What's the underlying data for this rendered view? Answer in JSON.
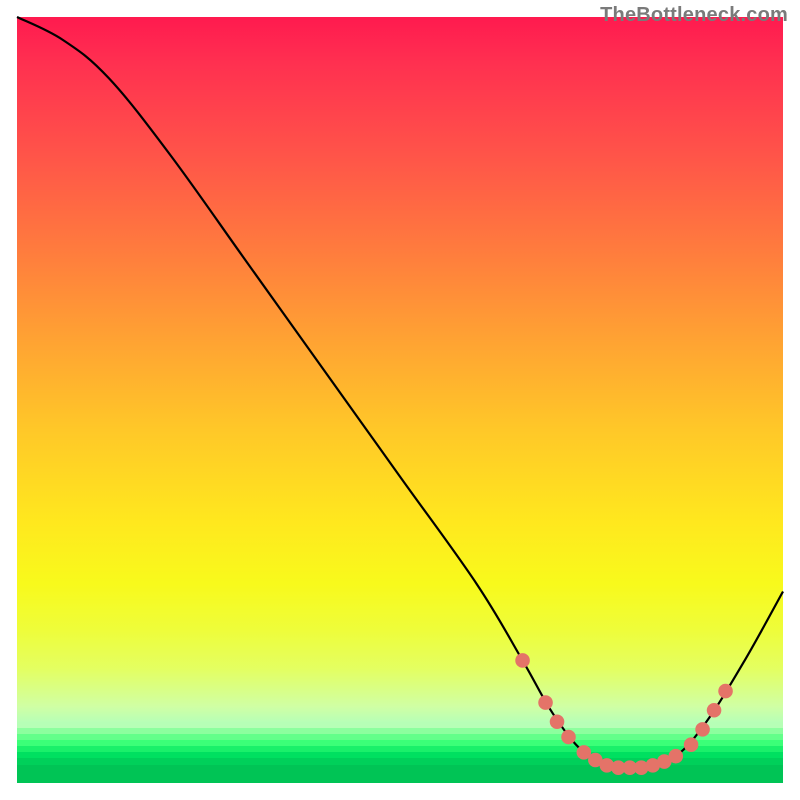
{
  "attribution": "TheBottleneck.com",
  "chart_data": {
    "type": "line",
    "title": "",
    "xlabel": "",
    "ylabel": "",
    "xlim": [
      0,
      100
    ],
    "ylim": [
      0,
      100
    ],
    "grid": false,
    "curve_points": [
      {
        "x": 0,
        "y": 100
      },
      {
        "x": 6,
        "y": 97
      },
      {
        "x": 12,
        "y": 92
      },
      {
        "x": 20,
        "y": 82
      },
      {
        "x": 30,
        "y": 68
      },
      {
        "x": 40,
        "y": 54
      },
      {
        "x": 50,
        "y": 40
      },
      {
        "x": 60,
        "y": 26
      },
      {
        "x": 66,
        "y": 16
      },
      {
        "x": 70,
        "y": 9
      },
      {
        "x": 74,
        "y": 4
      },
      {
        "x": 78,
        "y": 2
      },
      {
        "x": 82,
        "y": 2
      },
      {
        "x": 86,
        "y": 3.5
      },
      {
        "x": 90,
        "y": 8
      },
      {
        "x": 95,
        "y": 16
      },
      {
        "x": 100,
        "y": 25
      }
    ],
    "highlight_dots": [
      {
        "x": 66,
        "y": 16
      },
      {
        "x": 69,
        "y": 10.5
      },
      {
        "x": 70.5,
        "y": 8
      },
      {
        "x": 72,
        "y": 6
      },
      {
        "x": 74,
        "y": 4
      },
      {
        "x": 75.5,
        "y": 3
      },
      {
        "x": 77,
        "y": 2.3
      },
      {
        "x": 78.5,
        "y": 2
      },
      {
        "x": 80,
        "y": 2
      },
      {
        "x": 81.5,
        "y": 2
      },
      {
        "x": 83,
        "y": 2.3
      },
      {
        "x": 84.5,
        "y": 2.8
      },
      {
        "x": 86,
        "y": 3.5
      },
      {
        "x": 88,
        "y": 5
      },
      {
        "x": 89.5,
        "y": 7
      },
      {
        "x": 91,
        "y": 9.5
      },
      {
        "x": 92.5,
        "y": 12
      }
    ],
    "dot_color": "#e47368"
  }
}
